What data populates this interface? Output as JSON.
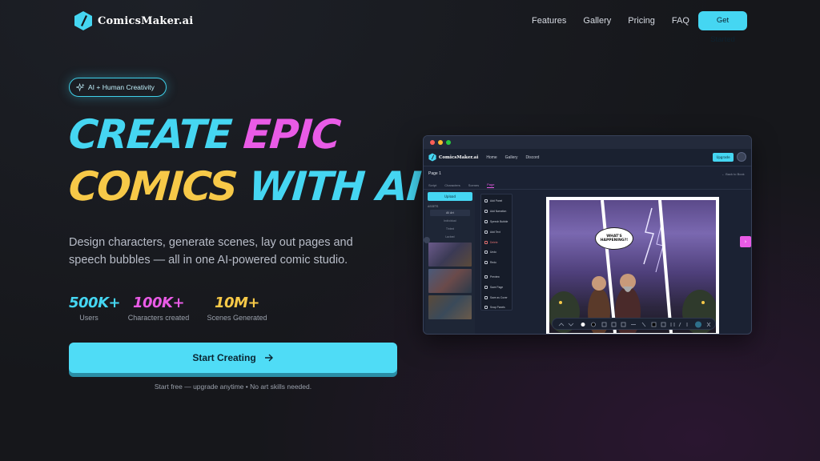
{
  "header": {
    "brand": "ComicsMaker.ai",
    "nav": [
      "Features",
      "Gallery",
      "Pricing",
      "FAQ"
    ],
    "cta": "Get Started"
  },
  "badge": {
    "text": "AI + Human Creativity",
    "icon": "sparkle-icon"
  },
  "hero": {
    "title_line1_word1": "Create",
    "title_line1_word2": "Epic",
    "title_line2_word1": "Comics",
    "title_line2_word2": "With AI",
    "subtitle": "Design characters, generate scenes, lay out pages and speech bubbles — all in one AI-powered comic studio."
  },
  "stats": [
    {
      "value": "500K+",
      "label": "Users",
      "color": "#45d6f2"
    },
    {
      "value": "100K+",
      "label": "Characters created",
      "color": "#e95be6"
    },
    {
      "value": "10M+",
      "label": "Scenes Generated",
      "color": "#f7c948"
    }
  ],
  "cta": {
    "label": "Start Creating",
    "note": "Start free — upgrade anytime • No art skills needed."
  },
  "app_preview": {
    "brand": "ComicsMaker.ai",
    "nav": [
      "Home",
      "Gallery",
      "Discord"
    ],
    "upgrade": "Upgrade",
    "page_title": "Page 1",
    "back_link": "← Back to Book",
    "tabs": [
      "Script",
      "Characters",
      "Scenes",
      "Page"
    ],
    "upload": "Upload",
    "assets_label": "ASSETS",
    "asset_items": [
      "All Art",
      "Individual",
      "Tinted",
      "Locked"
    ],
    "tools": [
      "Add Panel",
      "Add Narration",
      "Speech Bubble",
      "Add Text",
      "Delete",
      "Undo",
      "Redo",
      "Preview",
      "Save Page",
      "Save as Cover",
      "Snap Panels"
    ],
    "speech_bubble": "WHAT'S HAPPENING?!",
    "colors": {
      "cyan": "#45d6f2",
      "pink": "#e95be6",
      "yellow": "#f7c948"
    }
  }
}
